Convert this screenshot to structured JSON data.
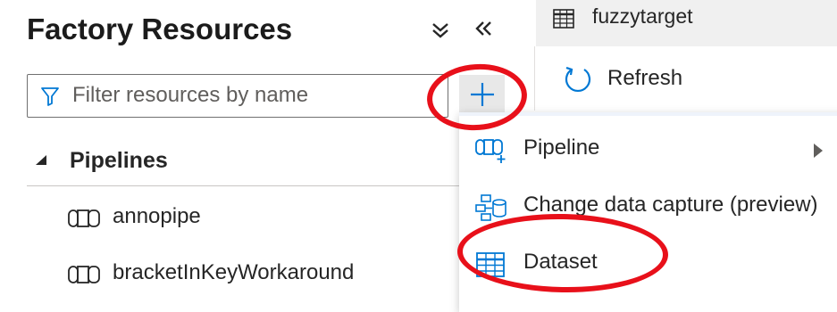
{
  "panel": {
    "title": "Factory Resources",
    "collapse_all_icon": "double-chevron-down-icon",
    "collapse_panel_icon": "double-chevron-left-icon"
  },
  "filter": {
    "placeholder": "Filter resources by name",
    "value": "",
    "icon": "filter-icon"
  },
  "add_button": {
    "icon": "plus-icon"
  },
  "tree": {
    "pipelines_label": "Pipelines",
    "items": [
      {
        "label": "annopipe"
      },
      {
        "label": "bracketInKeyWorkaround"
      }
    ]
  },
  "tab": {
    "label": "fuzzytarget",
    "icon": "table-icon"
  },
  "toolbar": {
    "refresh_label": "Refresh"
  },
  "menu": {
    "items": [
      {
        "label": "Pipeline",
        "icon": "pipeline-add-icon",
        "has_submenu": true
      },
      {
        "label": "Change data capture (preview)",
        "icon": "change-data-capture-icon"
      },
      {
        "label": "Dataset",
        "icon": "dataset-table-icon"
      }
    ]
  },
  "colors": {
    "accent": "#0078d4",
    "annotation": "#e8101a",
    "tab_bg": "#f0f0f0",
    "add_button_bg": "#e8e8e8"
  }
}
